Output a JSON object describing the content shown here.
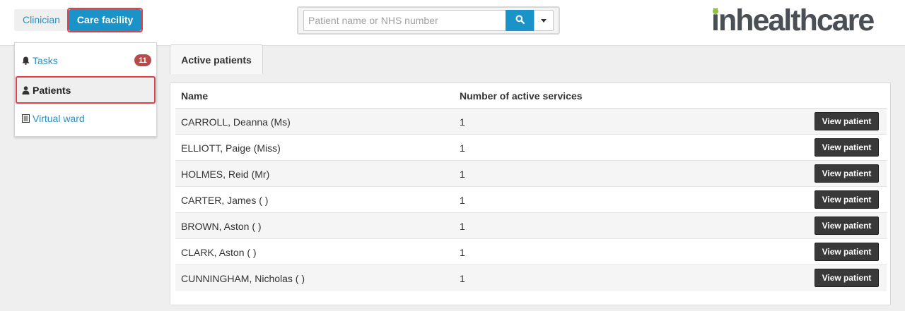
{
  "header": {
    "roles": {
      "clinician": "Clinician",
      "care_facility": "Care facility"
    },
    "search": {
      "placeholder": "Patient name or NHS number"
    },
    "logo": "inhealthcare"
  },
  "sidebar": {
    "items": [
      {
        "label": "Tasks",
        "icon": "bell-icon",
        "badge": "11"
      },
      {
        "label": "Patients",
        "icon": "user-icon"
      },
      {
        "label": "Virtual ward",
        "icon": "list-icon"
      }
    ]
  },
  "main": {
    "tab": "Active patients",
    "columns": {
      "name": "Name",
      "services": "Number of active services"
    },
    "button_label": "View patient",
    "rows": [
      {
        "name": "CARROLL, Deanna (Ms)",
        "count": "1"
      },
      {
        "name": "ELLIOTT, Paige (Miss)",
        "count": "1"
      },
      {
        "name": "HOLMES, Reid (Mr)",
        "count": "1"
      },
      {
        "name": "CARTER, James ( )",
        "count": "1"
      },
      {
        "name": "BROWN, Aston ( )",
        "count": "1"
      },
      {
        "name": "CLARK, Aston ( )",
        "count": "1"
      },
      {
        "name": "CUNNINGHAM, Nicholas ( )",
        "count": "1"
      }
    ]
  },
  "colors": {
    "accent": "#1a93c8",
    "highlight": "#e0424a",
    "badge": "#b94a48",
    "logo_dot": "#8cc63f"
  }
}
